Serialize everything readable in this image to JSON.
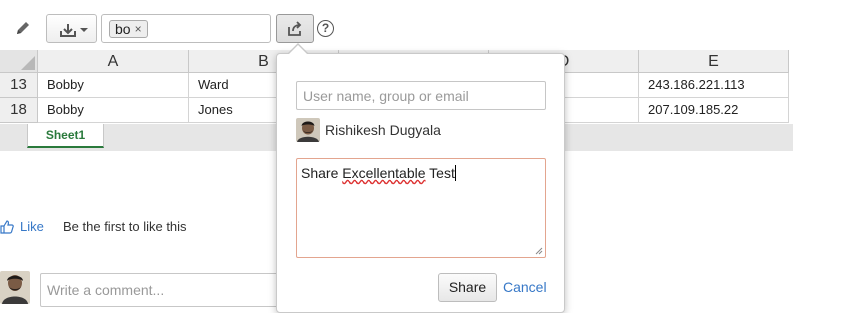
{
  "toolbar": {
    "filter_tag": "bo",
    "filter_tag_remove": "×",
    "help": "?"
  },
  "grid": {
    "columns": [
      "A",
      "B",
      "",
      "D",
      "E"
    ],
    "rows": [
      {
        "num": "13",
        "cells": [
          "Bobby",
          "Ward",
          "",
          "",
          "243.186.221.113"
        ]
      },
      {
        "num": "18",
        "cells": [
          "Bobby",
          "Jones",
          "",
          "",
          "207.109.185.22"
        ]
      }
    ]
  },
  "sheet_tab": "Sheet1",
  "like": {
    "link": "Like",
    "text": "Be the first to like this"
  },
  "comment": {
    "placeholder": "Write a comment..."
  },
  "share_popup": {
    "input_placeholder": "User name, group or email",
    "user_name": "Rishikesh Dugyala",
    "message_before": "Share ",
    "message_misspelled": "Excellentable",
    "message_after": " Test",
    "share_button": "Share",
    "cancel_link": "Cancel"
  }
}
